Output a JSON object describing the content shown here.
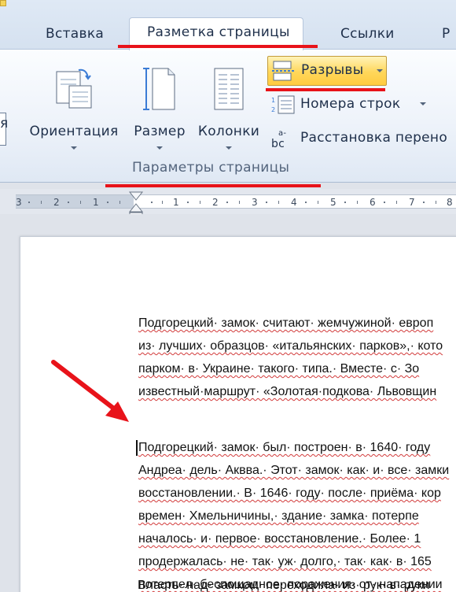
{
  "ribbon": {
    "tabs": [
      {
        "label": "Вставка"
      },
      {
        "label": "Разметка страницы",
        "active": true
      },
      {
        "label": "Ссылки"
      },
      {
        "label": "Р"
      }
    ],
    "left_edge_label": "я",
    "big_buttons": [
      {
        "label": "Ориентация",
        "icon": "orientation-icon"
      },
      {
        "label": "Размер",
        "icon": "page-size-icon"
      },
      {
        "label": "Колонки",
        "icon": "columns-icon"
      }
    ],
    "small_buttons": [
      {
        "label": "Разрывы",
        "icon": "breaks-icon",
        "highlighted": true
      },
      {
        "label": "Номера строк",
        "icon": "line-numbers-icon"
      },
      {
        "label": "Расстановка перено",
        "icon": "hyphenation-icon"
      }
    ],
    "group_label": "Параметры страницы",
    "highlight_color": "#e8131a"
  },
  "ruler": {
    "numbers": [
      "3",
      "2",
      "1",
      "1",
      "2",
      "3",
      "4",
      "5",
      "6",
      "7",
      "8"
    ]
  },
  "document": {
    "paragraph1": [
      "Подгорецкий· замок· считают· жемчужиной· европ",
      "из· лучших· образцов· «итальянских· парков»,· кото",
      "парком· в· Украине· такого· типа.· Вместе· с· Зо",
      "известный·маршрут· «Золотая·подкова· Львовщин"
    ],
    "paragraph2": [
      "Подгорецкий· замок· был· построен· в· 1640· году",
      "Андреа· дель· Аквва.· Этот· замок· как· и· все· замки",
      "восстановлении.· В· 1646· году· после· приёма· кор",
      "времен· Хмельничины,· здание· замка· потерпе",
      "началось· и· первое· восстановление.· Более· 1",
      "продержалась· не· так· уж· долго,· так· как· в· 165",
      "потерпел· беспощадное· поражения· от· нападении"
    ],
    "paragraph3": [
      "Власть· над· замком· переходила· из· рук· в· руки"
    ]
  }
}
